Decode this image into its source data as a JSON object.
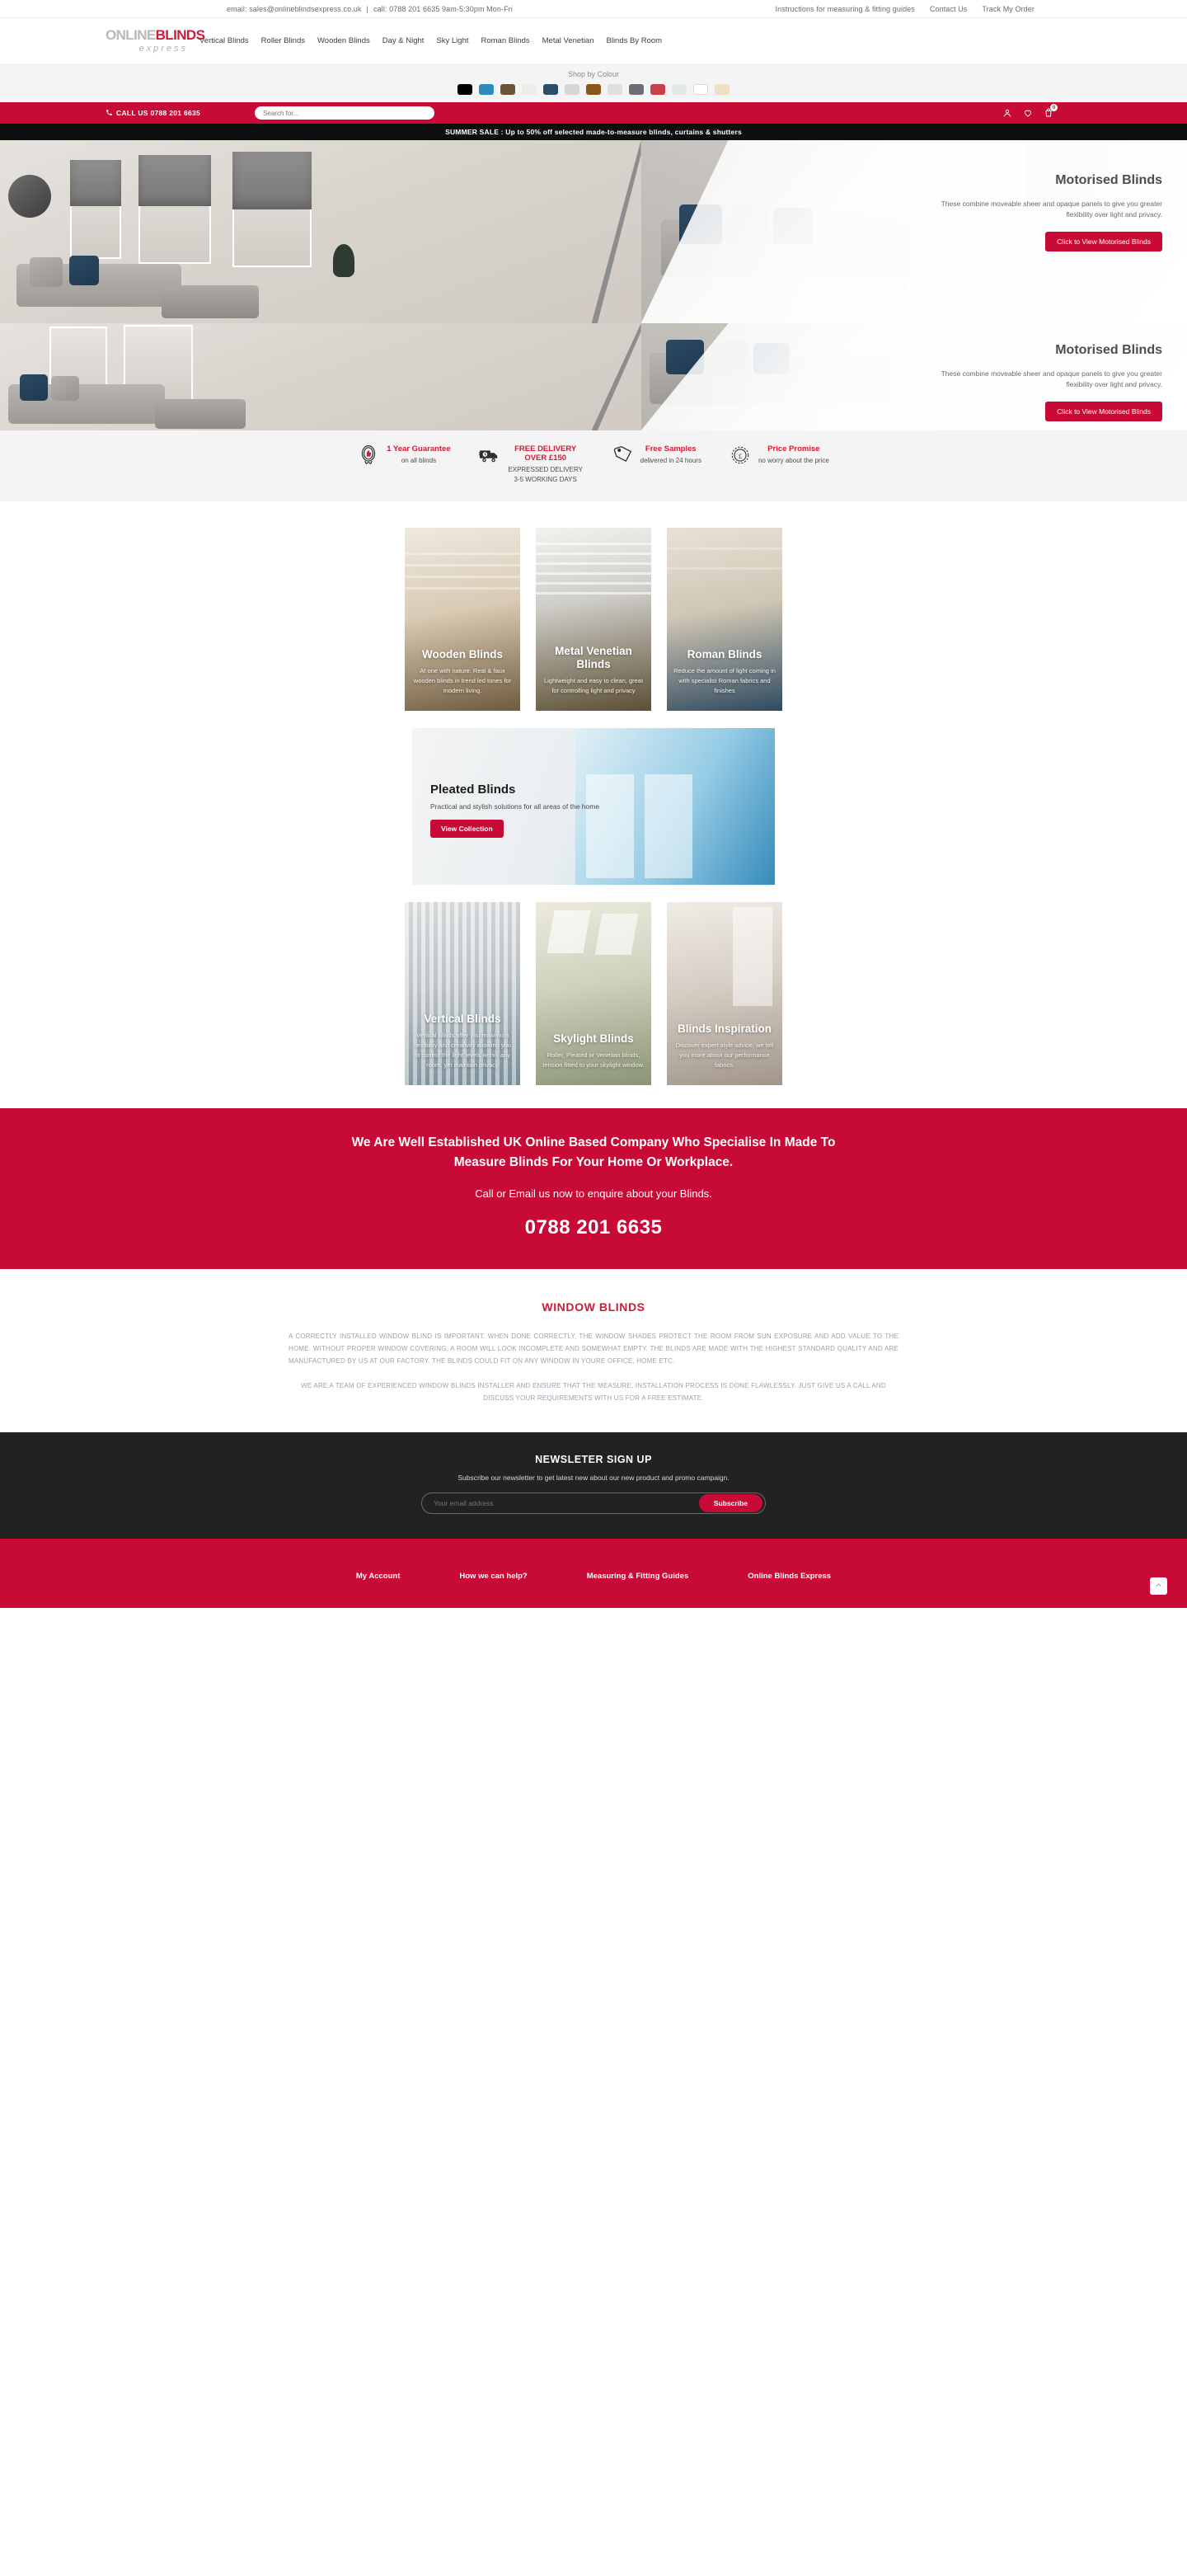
{
  "topbar": {
    "email_text": "email: sales@onlineblindsexpress.co.uk",
    "divider": "|",
    "phone_text": "call: 0788 201 6635 9am-5:30pm Mon-Fri",
    "links": [
      {
        "label": "Instructions for measuring & fitting guides"
      },
      {
        "label": "Contact Us"
      },
      {
        "label": "Track My Order"
      }
    ]
  },
  "brand": {
    "logo_part1": "ONLINE",
    "logo_part2": "BLINDS",
    "logo_sub": "express"
  },
  "nav": {
    "items": [
      {
        "label": "Vertical Blinds"
      },
      {
        "label": "Roller Blinds"
      },
      {
        "label": "Wooden Blinds"
      },
      {
        "label": "Day & Night"
      },
      {
        "label": "Sky Light"
      },
      {
        "label": "Roman Blinds"
      },
      {
        "label": "Metal Venetian"
      },
      {
        "label": "Blinds By Room"
      }
    ]
  },
  "colourbar": {
    "title": "Shop by Colour",
    "swatches": [
      {
        "name": "black",
        "hex": "#000000"
      },
      {
        "name": "blue",
        "hex": "#2b8cbe"
      },
      {
        "name": "brown",
        "hex": "#6b5438"
      },
      {
        "name": "cream",
        "hex": "#ececeb"
      },
      {
        "name": "navy",
        "hex": "#2c4e68"
      },
      {
        "name": "silver",
        "hex": "#d8d6d2"
      },
      {
        "name": "tan",
        "hex": "#8a5618"
      },
      {
        "name": "pearl",
        "hex": "#dedfdf"
      },
      {
        "name": "grey",
        "hex": "#6c6d78"
      },
      {
        "name": "red",
        "hex": "#c9404c"
      },
      {
        "name": "ice",
        "hex": "#e2e8ea"
      },
      {
        "name": "white",
        "hex": "#ffffff"
      },
      {
        "name": "beige",
        "hex": "#f0dfc2"
      }
    ]
  },
  "search": {
    "call_label": "CALL US 0788 201 6635",
    "placeholder": "Search for...",
    "cart_count": "0"
  },
  "promo": {
    "text": "SUMMER SALE : Up to 50% off selected made-to-measure blinds, curtains & shutters"
  },
  "hero_slides": [
    {
      "title": "Motorised Blinds",
      "desc": "These combine moveable sheer and opaque panels to give you greater flexibility over light and privacy.",
      "button": "Click to View Motorised Blinds"
    },
    {
      "title": "Motorised Blinds",
      "desc": "These combine moveable sheer and opaque panels to give you greater flexibility over light and privacy.",
      "button": "Click to View Motorised Blinds"
    }
  ],
  "usps": [
    {
      "icon": "guarantee-badge-icon",
      "title": "1 Year Guarantee",
      "sub": "on all blinds"
    },
    {
      "icon": "delivery-truck-icon",
      "title": "FREE DELIVERY OVER £150",
      "sub": "EXPRESSED DELIVERY\n3-5 WORKING DAYS"
    },
    {
      "icon": "free-tag-icon",
      "title": "Free Samples",
      "sub": "delivered in 24 hours"
    },
    {
      "icon": "price-seal-icon",
      "title": "Price Promise",
      "sub": "no worry about the price"
    }
  ],
  "cards_row1": [
    {
      "title": "Wooden Blinds",
      "sub": "At one with nature. Real & faux wooden blinds in trend led tones for modern living.",
      "art": "art-wooden"
    },
    {
      "title": "Metal Venetian Blinds",
      "sub": "Lightweight and easy to clean, great for controlling light and privacy",
      "art": "art-metal"
    },
    {
      "title": "Roman Blinds",
      "sub": "Reduce the amount of light coming in with specialist Roman fabrics and finishes",
      "art": "art-roman"
    }
  ],
  "pleated": {
    "title": "Pleated Blinds",
    "sub": "Practical and stylish solutions for all areas of the home",
    "button": "View Collection"
  },
  "cards_row2": [
    {
      "title": "Vertical Blinds",
      "sub": "Vertical blinds offer you maximum flexibility and creativity allowing you to control the light levels within any room, yet maintain privacy",
      "art": "art-vertical"
    },
    {
      "title": "Skylight Blinds",
      "sub": "Roller, Pleated or Venetian blinds, tension fitted to your skylight window.",
      "art": "art-skylight"
    },
    {
      "title": "Blinds Inspiration",
      "sub": "Discover expert style advice, we tell you more about our performance fabrics.",
      "art": "art-inspiration"
    }
  ],
  "cta": {
    "line1": "We Are Well Established UK Online Based Company Who Specialise In Made To Measure Blinds For Your Home Or Workplace.",
    "line2": "Call or Email us now to enquire about your Blinds.",
    "phone": "0788 201 6635"
  },
  "window_blinds": {
    "title": "WINDOW BLINDS",
    "para1": "A CORRECTLY INSTALLED WINDOW BLIND IS IMPORTANT. WHEN DONE CORRECTLY, THE WINDOW SHADES PROTECT THE ROOM FROM SUN EXPOSURE AND ADD VALUE TO THE HOME. WITHOUT PROPER WINDOW COVERING, A ROOM WILL LOOK INCOMPLETE AND SOMEWHAT EMPTY. THE BLINDS ARE MADE WITH THE HIGHEST STANDARD QUALITY AND ARE MANUFACTURED BY US AT OUR FACTORY. THE BLINDS COULD FIT ON ANY WINDOW IN YOURE OFFICE, HOME ETC.",
    "para2": "WE ARE A TEAM OF EXPERIENCED WINDOW BLINDS INSTALLER AND ENSURE THAT THE MEASURE, INSTALLATION PROCESS IS DONE FLAWLESSLY.  JUST GIVE US A CALL AND DISCUSS YOUR REQUIREMENTS WITH US FOR A FREE ESTIMATE."
  },
  "newsletter": {
    "title": "NEWSLETER SIGN UP",
    "sub": "Subscribe our newsletter to get latest new about our new product and promo campaign.",
    "placeholder": "Your email address",
    "button": "Subscribe"
  },
  "footer": {
    "columns": [
      {
        "label": "My Account"
      },
      {
        "label": "How we can help?"
      },
      {
        "label": "Measuring & Fitting Guides"
      },
      {
        "label": "Online Blinds Express"
      }
    ],
    "to_top_icon": "chevron-up-icon"
  },
  "colors": {
    "brand_red": "#c80a36",
    "logo_red": "#d21a35",
    "dark": "#222222",
    "light_grey": "#f4f4f4"
  }
}
